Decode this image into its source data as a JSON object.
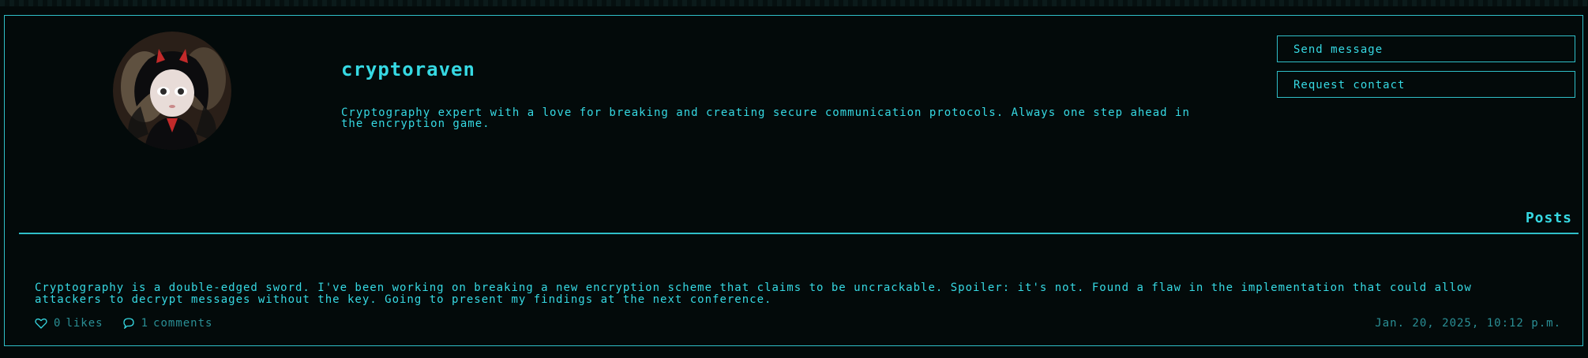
{
  "profile": {
    "username": "cryptoraven",
    "bio": "Cryptography expert with a love for breaking and creating secure communication protocols. Always one step ahead in the encryption game.",
    "avatar_icon": "doll-avatar"
  },
  "actions": {
    "send_message": "Send message",
    "request_contact": "Request contact"
  },
  "posts_section": {
    "title": "Posts"
  },
  "posts": [
    {
      "text": "Cryptography is a double-edged sword. I've been working on breaking a new encryption scheme that claims to be uncrackable. Spoiler: it's not. Found a flaw in the implementation that could allow attackers to decrypt messages without the key. Going to present my findings at the next conference.",
      "likes_count": "0",
      "likes_label": "likes",
      "comments_count": "1",
      "comments_label": "comments",
      "date": "Jan. 20, 2025, 10:12 p.m.",
      "like_icon": "heart-icon",
      "comment_icon": "comment-icon"
    }
  ],
  "colors": {
    "background": "#030a0a",
    "accent": "#36d9e3",
    "border": "#2fbfc8",
    "muted": "#2a8f95"
  }
}
